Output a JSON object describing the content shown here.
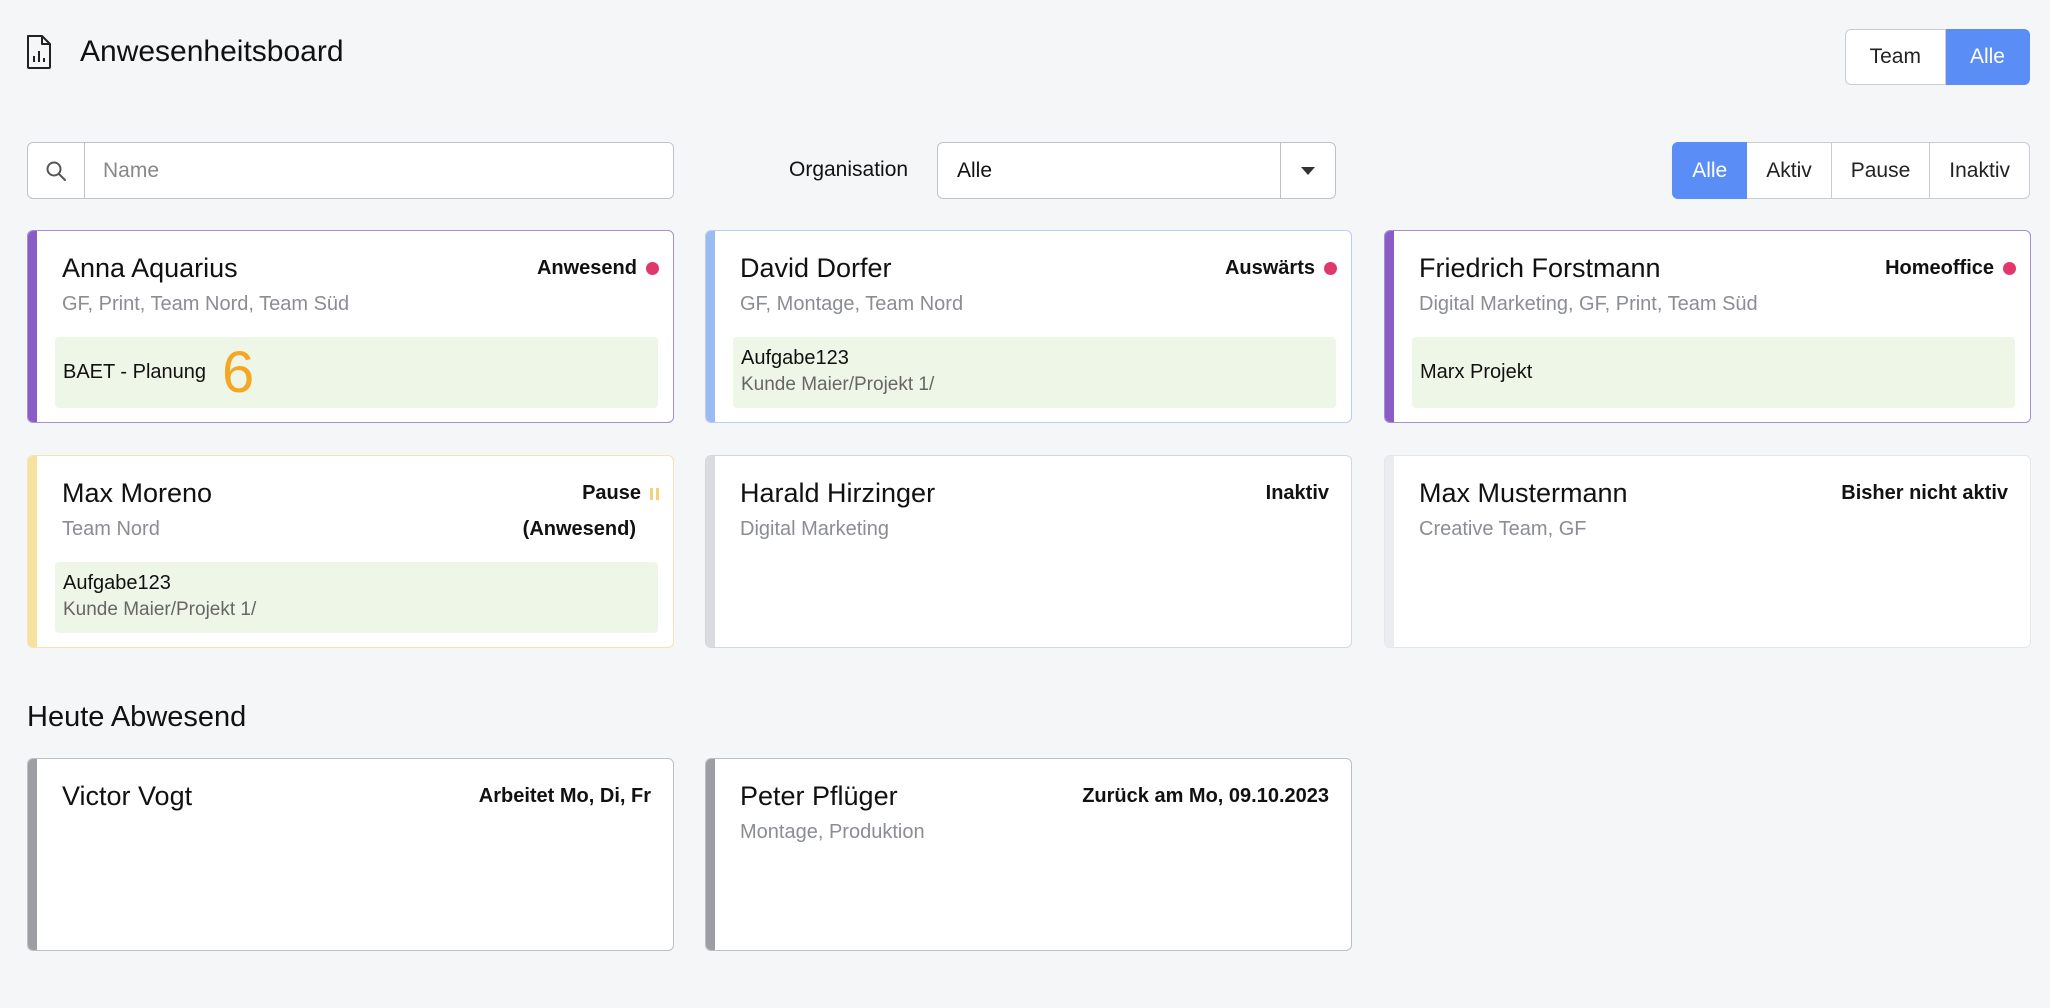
{
  "header": {
    "title": "Anwesenheitsboard"
  },
  "view_toggle": {
    "options": [
      "Team",
      "Alle"
    ],
    "selected": "Alle"
  },
  "filters": {
    "search": {
      "placeholder": "Name",
      "value": ""
    },
    "organisation": {
      "label": "Organisation",
      "value": "Alle"
    },
    "status_options": [
      "Alle",
      "Aktiv",
      "Pause",
      "Inaktiv"
    ],
    "status_selected": "Alle"
  },
  "colors": {
    "accent": "#5b8df6",
    "status_dot": "#e0386a",
    "task_bg": "#eef6e8",
    "badge": "#f5a623",
    "bar_purple": "#8a5cc7",
    "bar_blue": "#9bbcf2",
    "bar_yellow": "#f7e1a0",
    "bar_light_gray": "#d9dbdf",
    "bar_gray": "#9c9ea3"
  },
  "employees": [
    {
      "name": "Anna Aquarius",
      "teams": "GF, Print, Team Nord, Team Süd",
      "status": "Anwesend",
      "indicator": "dot",
      "task_title": "BAET - Planung",
      "task_sub": "",
      "badge": "6"
    },
    {
      "name": "David Dorfer",
      "teams": "GF, Montage, Team Nord",
      "status": "Auswärts",
      "indicator": "dot",
      "task_title": "Aufgabe123",
      "task_sub": "Kunde Maier/Projekt 1/"
    },
    {
      "name": "Friedrich Forstmann",
      "teams": "Digital Marketing, GF, Print, Team Süd",
      "status": "Homeoffice",
      "indicator": "dot",
      "task_title": "Marx Projekt",
      "task_sub": ""
    },
    {
      "name": "Max Moreno",
      "teams": "Team Nord",
      "status": "Pause",
      "substatus": "(Anwesend)",
      "indicator": "pause-icon",
      "task_title": "Aufgabe123",
      "task_sub": "Kunde Maier/Projekt 1/"
    },
    {
      "name": "Harald Hirzinger",
      "teams": "Digital Marketing",
      "status": "Inaktiv"
    },
    {
      "name": "Max Mustermann",
      "teams": "Creative Team, GF",
      "status": "Bisher nicht aktiv"
    }
  ],
  "absent_section": {
    "title": "Heute Abwesend",
    "employees": [
      {
        "name": "Victor Vogt",
        "teams": "",
        "status": "Arbeitet Mo, Di, Fr"
      },
      {
        "name": "Peter Pflüger",
        "teams": "Montage, Produktion",
        "status": "Zurück am Mo, 09.10.2023"
      }
    ]
  }
}
